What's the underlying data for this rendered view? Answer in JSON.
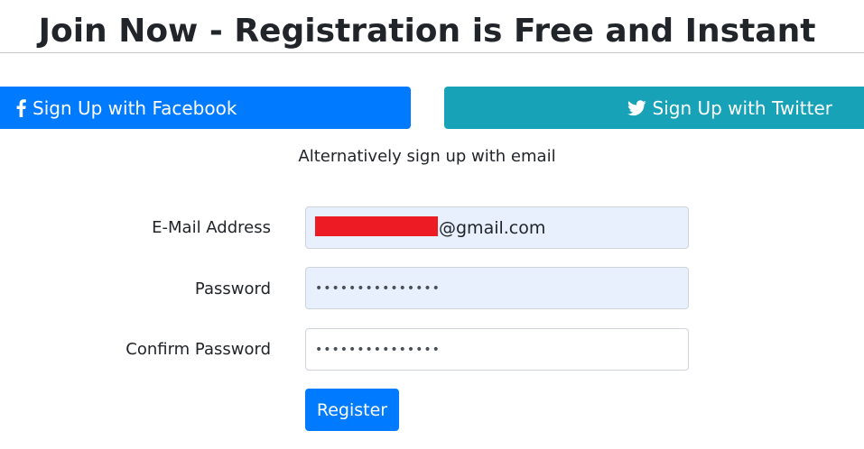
{
  "header": {
    "title": "Join Now - Registration is Free and Instant"
  },
  "social": {
    "facebook": {
      "label": "Sign Up with Facebook",
      "icon": "facebook-icon",
      "color": "#007bff"
    },
    "twitter": {
      "label": "Sign Up with Twitter",
      "icon": "twitter-icon",
      "color": "#17a2b8"
    }
  },
  "alternative_text": "Alternatively sign up with email",
  "form": {
    "email": {
      "label": "E-Mail Address",
      "value_visible": "@gmail.com"
    },
    "password": {
      "label": "Password",
      "value_masked": "•••••••••••••••"
    },
    "confirm_password": {
      "label": "Confirm Password",
      "value_masked": "•••••••••••••••"
    },
    "submit_label": "Register"
  },
  "colors": {
    "primary": "#007bff",
    "info": "#17a2b8",
    "autofill_bg": "#e8f0fe",
    "redaction": "#ed1c24",
    "text": "#212529"
  }
}
